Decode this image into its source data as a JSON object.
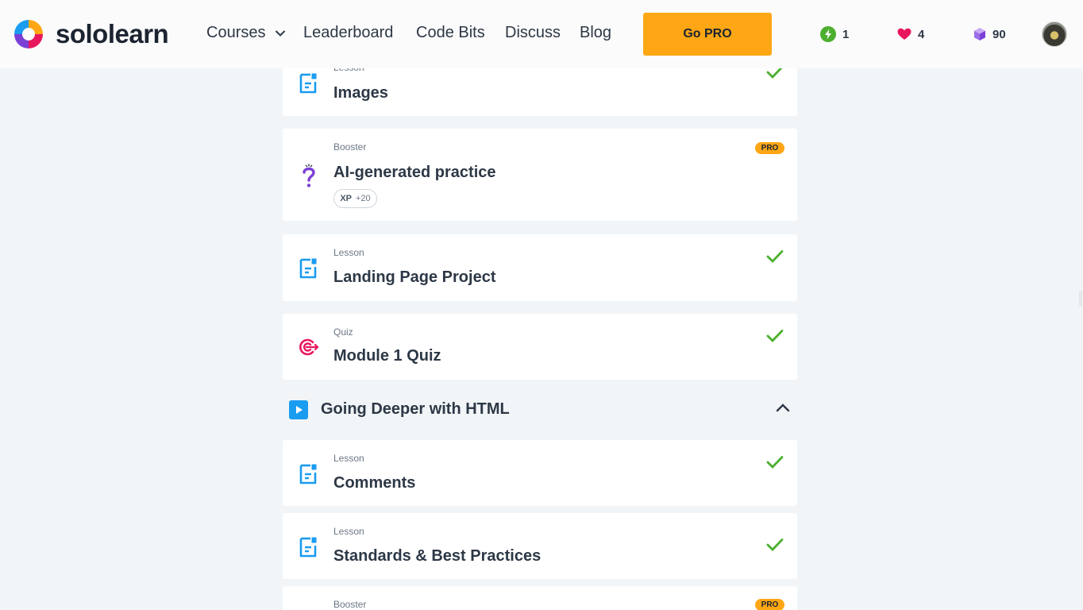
{
  "brand": {
    "name": "sololearn"
  },
  "nav": {
    "items": [
      {
        "label": "Courses",
        "has_dropdown": true
      },
      {
        "label": "Leaderboard"
      },
      {
        "label": "Code Bits"
      },
      {
        "label": "Discuss"
      },
      {
        "label": "Blog"
      }
    ],
    "cta_label": "Go PRO"
  },
  "stats": {
    "streak": "1",
    "hearts": "4",
    "bits": "90"
  },
  "colors": {
    "accent": "#fea613",
    "check": "#4caf2f",
    "lesson_icon": "#1a9cf0",
    "quiz_icon": "#e8175d",
    "booster_icon": "#7b3fd6"
  },
  "items": [
    {
      "kind": "Lesson",
      "title": "Images",
      "icon": "document-icon",
      "completed": true
    },
    {
      "kind": "Booster",
      "title": "AI-generated practice",
      "icon": "question-mark-icon",
      "badge": "PRO",
      "xp_label": "XP",
      "xp_value": "+20"
    },
    {
      "kind": "Lesson",
      "title": "Landing Page Project",
      "icon": "document-icon",
      "completed": true
    },
    {
      "kind": "Quiz",
      "title": "Module 1 Quiz",
      "icon": "target-icon",
      "completed": true
    }
  ],
  "module": {
    "title": "Going Deeper with HTML",
    "expanded": true,
    "items": [
      {
        "kind": "Lesson",
        "title": "Comments",
        "icon": "document-icon",
        "completed": true
      },
      {
        "kind": "Lesson",
        "title": "Standards & Best Practices",
        "icon": "document-icon",
        "completed": true
      },
      {
        "kind": "Booster",
        "badge": "PRO",
        "icon": "question-mark-icon"
      }
    ]
  }
}
